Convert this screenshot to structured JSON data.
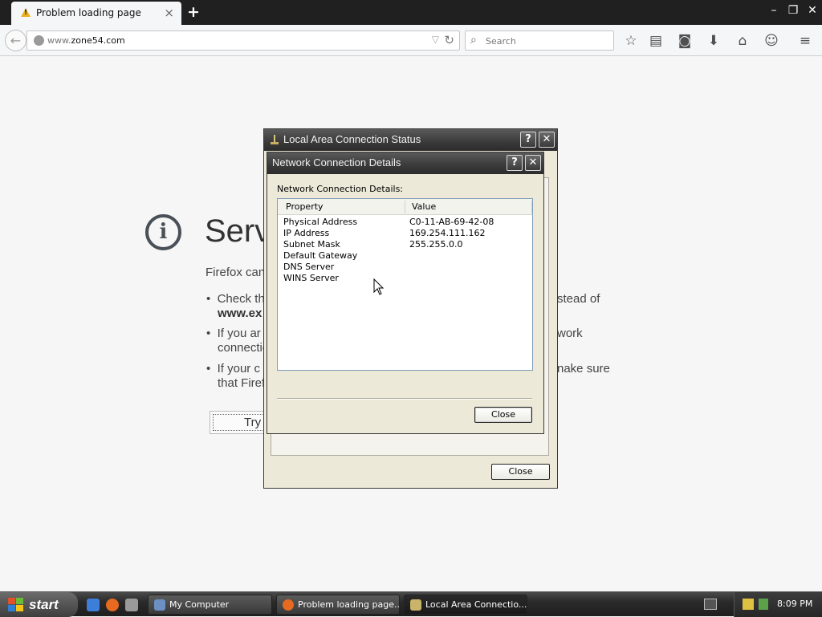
{
  "browser": {
    "tab_title": "Problem loading page",
    "url_prefix": "www.",
    "url_host": "zone54.com",
    "search_placeholder": "Search"
  },
  "error_page": {
    "title_visible": "Serv",
    "lead_visible": "Firefox can",
    "bullet1_line1": "Check th",
    "bullet1_line1_right": "stead of",
    "bullet1_line2": "www.ex",
    "bullet2_line1": "If you ar",
    "bullet2_line1_right": "work",
    "bullet2_line2": "connectio",
    "bullet3_line1": "If your c",
    "bullet3_line1_right": "nake sure",
    "bullet3_line2": "that Firef",
    "try_button": "Try"
  },
  "status_dialog": {
    "title": "Local Area Connection Status",
    "close_button": "Close"
  },
  "details_dialog": {
    "title": "Network Connection Details",
    "group_label": "Network Connection Details:",
    "col_property": "Property",
    "col_value": "Value",
    "rows": [
      {
        "property": "Physical Address",
        "value": "C0-11-AB-69-42-08"
      },
      {
        "property": "IP Address",
        "value": "169.254.111.162"
      },
      {
        "property": "Subnet Mask",
        "value": "255.255.0.0"
      },
      {
        "property": "Default Gateway",
        "value": ""
      },
      {
        "property": "DNS Server",
        "value": ""
      },
      {
        "property": "WINS Server",
        "value": ""
      }
    ],
    "close_button": "Close"
  },
  "taskbar": {
    "start_label": "start",
    "tasks": [
      {
        "label": "My Computer"
      },
      {
        "label": "Problem loading page..."
      },
      {
        "label": "Local Area Connectio..."
      }
    ],
    "clock": "8:09 PM"
  }
}
